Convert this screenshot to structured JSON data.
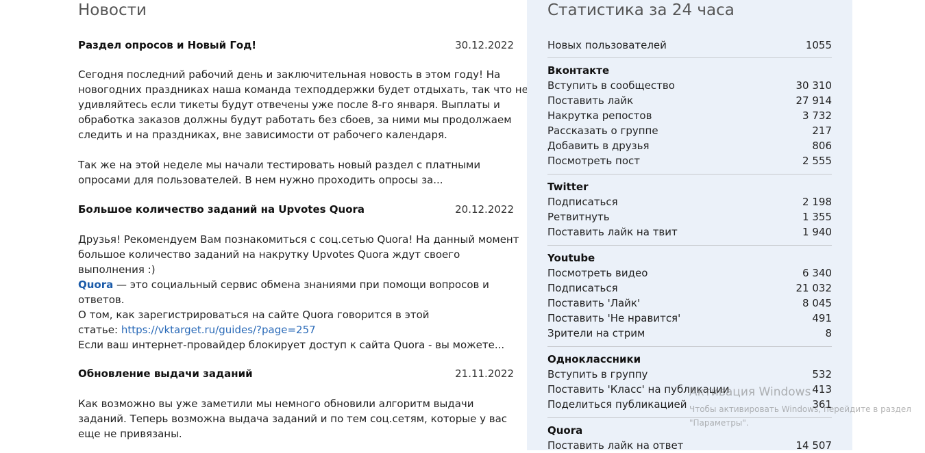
{
  "news": {
    "heading": "Новости",
    "articles": [
      {
        "title": "Раздел опросов и Новый Год!",
        "date": "30.12.2022",
        "lines": [
          "Сегодня последний рабочий день и заключительная новость в этом году! На",
          "новогодних праздниках наша команда техподдержки будет отдыхать, так что не",
          "удивляйтесь если тикеты будут отвечены уже после 8-го января. Выплаты и",
          "обработка заказов должны будут работать без сбоев, за ними мы продолжаем",
          "следить и на праздниках, вне зависимости от рабочего календаря.",
          "",
          "Так же на этой неделе мы начали тестировать новый раздел с платными",
          "опросами для пользователей. В нем нужно проходить опросы за..."
        ]
      },
      {
        "title": "Большое количество заданий на Upvotes Quora",
        "date": "20.12.2022",
        "lines": [
          "Друзья! Рекомендуем Вам познакомиться с соц.сетью Quora! На данный момент",
          "большое количество заданий на накрутку Upvotes Quora ждут своего",
          "выполнения :)"
        ],
        "quora_word": "Quora",
        "quora_rest_1": " — это социальный сервис обмена знаниями при помощи вопросов и",
        "quora_rest_2": "ответов.",
        "register_line": "О том, как зарегистрироваться на сайте Quora говорится в этой",
        "article_prefix": "статье: ",
        "link": "https://vktarget.ru/guides/?page=257",
        "last_line": "Если ваш интернет-провайдер блокирует доступ к сайта Quora - вы можете..."
      },
      {
        "title": "Обновление выдачи заданий",
        "date": "21.11.2022",
        "lines": [
          "Как возможно вы уже заметили мы немного обновили алгоритм выдачи",
          "заданий. Теперь возможна выдача заданий и по тем соц.сетям, которые у вас",
          "еще не привязаны."
        ]
      }
    ]
  },
  "stats": {
    "heading": "Статистика за 24 часа",
    "new_users": {
      "label": "Новых пользователей",
      "value": "1055"
    },
    "groups": [
      {
        "title": "Вконтакте",
        "rows": [
          {
            "label": "Вступить в сообщество",
            "value": "30 310"
          },
          {
            "label": "Поставить лайк",
            "value": "27 914"
          },
          {
            "label": "Накрутка репостов",
            "value": "3 732"
          },
          {
            "label": "Рассказать о группе",
            "value": "217"
          },
          {
            "label": "Добавить в друзья",
            "value": "806"
          },
          {
            "label": "Посмотреть пост",
            "value": "2 555"
          }
        ]
      },
      {
        "title": "Twitter",
        "rows": [
          {
            "label": "Подписаться",
            "value": "2 198"
          },
          {
            "label": "Ретвитнуть",
            "value": "1 355"
          },
          {
            "label": "Поставить лайк на твит",
            "value": "1 940"
          }
        ]
      },
      {
        "title": "Youtube",
        "rows": [
          {
            "label": "Посмотреть видео",
            "value": "6 340"
          },
          {
            "label": "Подписаться",
            "value": "21 032"
          },
          {
            "label": "Поставить 'Лайк'",
            "value": "8 045"
          },
          {
            "label": "Поставить 'Не нравится'",
            "value": "491"
          },
          {
            "label": "Зрители на стрим",
            "value": "8"
          }
        ]
      },
      {
        "title": "Одноклассники",
        "rows": [
          {
            "label": "Вступить в группу",
            "value": "532"
          },
          {
            "label": "Поставить 'Класс' на публикации",
            "value": "413"
          },
          {
            "label": "Поделиться публикацией",
            "value": "361"
          }
        ]
      },
      {
        "title": "Quora",
        "rows": [
          {
            "label": "Поставить лайк на ответ",
            "value": "14 507"
          }
        ]
      }
    ]
  },
  "watermark": {
    "title": "Активация Windows",
    "text": "Чтобы активировать Windows, перейдите в раздел \"Параметры\"."
  }
}
